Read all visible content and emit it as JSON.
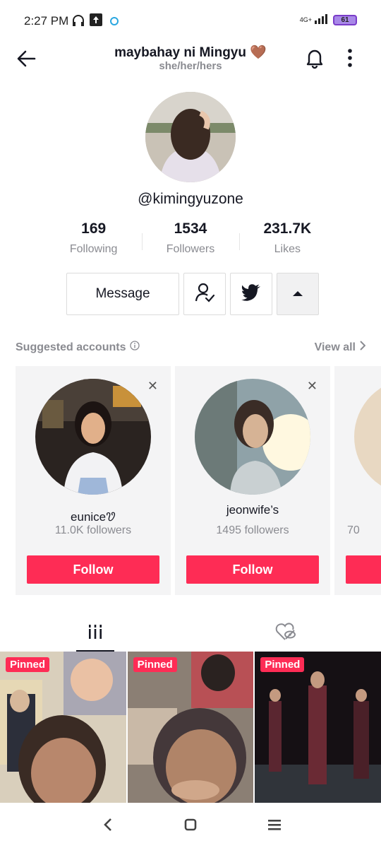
{
  "status": {
    "time": "2:27 PM",
    "network": "4G+",
    "battery": "61"
  },
  "header": {
    "title": "maybahay ni Mingyu 🤎",
    "pronouns": "she/her/hers"
  },
  "profile": {
    "handle": "@kimingyuzone",
    "stats": [
      {
        "value": "169",
        "label": "Following"
      },
      {
        "value": "1534",
        "label": "Followers"
      },
      {
        "value": "231.7K",
        "label": "Likes"
      }
    ],
    "message_label": "Message"
  },
  "suggested": {
    "title": "Suggested accounts",
    "view_all": "View all",
    "cards": [
      {
        "name": "eunice🝣",
        "followers": "11.0K followers",
        "button": "Follow"
      },
      {
        "name": "jeonwife’s",
        "followers": "1495 followers",
        "button": "Follow"
      },
      {
        "followers_partial": "70"
      }
    ]
  },
  "videos": [
    {
      "badge": "Pinned"
    },
    {
      "badge": "Pinned"
    },
    {
      "badge": "Pinned"
    }
  ],
  "colors": {
    "accent": "#fe2c55",
    "muted": "#8a8b91",
    "text": "#161823"
  }
}
